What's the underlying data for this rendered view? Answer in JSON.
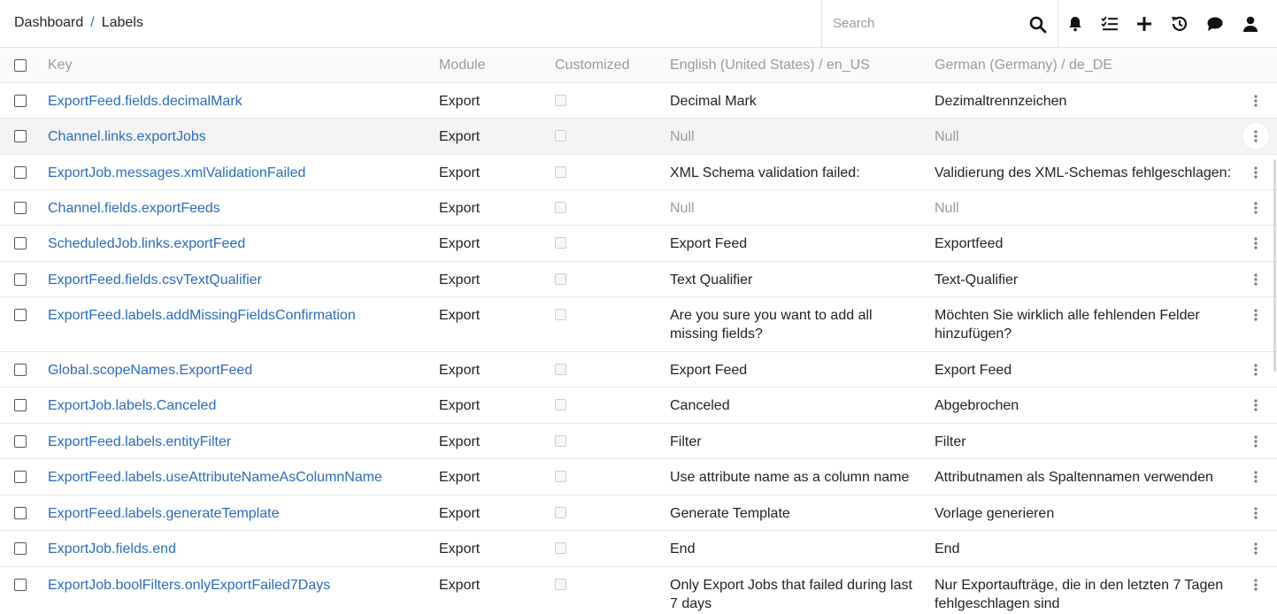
{
  "breadcrumb": {
    "root": "Dashboard",
    "separator": "/",
    "current": "Labels"
  },
  "search": {
    "placeholder": "Search",
    "value": ""
  },
  "header_icons": [
    "bell-icon",
    "tasks-icon",
    "plus-icon",
    "history-icon",
    "chat-icon",
    "user-icon"
  ],
  "table": {
    "columns": {
      "key": "Key",
      "module": "Module",
      "customized": "Customized",
      "en": "English (United States) / en_US",
      "de": "German (Germany) / de_DE"
    },
    "rows": [
      {
        "key": "ExportFeed.fields.decimalMark",
        "module": "Export",
        "en": "Decimal Mark",
        "de": "Dezimaltrennzeichen"
      },
      {
        "key": "Channel.links.exportJobs",
        "module": "Export",
        "en": "Null",
        "de": "Null"
      },
      {
        "key": "ExportJob.messages.xmlValidationFailed",
        "module": "Export",
        "en": "XML Schema validation failed:",
        "de": "Validierung des XML-Schemas fehlgeschlagen:"
      },
      {
        "key": "Channel.fields.exportFeeds",
        "module": "Export",
        "en": "Null",
        "de": "Null"
      },
      {
        "key": "ScheduledJob.links.exportFeed",
        "module": "Export",
        "en": "Export Feed",
        "de": "Exportfeed"
      },
      {
        "key": "ExportFeed.fields.csvTextQualifier",
        "module": "Export",
        "en": "Text Qualifier",
        "de": "Text-Qualifier"
      },
      {
        "key": "ExportFeed.labels.addMissingFieldsConfirmation",
        "module": "Export",
        "en": "Are you sure you want to add all missing fields?",
        "de": "Möchten Sie wirklich alle fehlenden Felder hinzufügen?"
      },
      {
        "key": "Global.scopeNames.ExportFeed",
        "module": "Export",
        "en": "Export Feed",
        "de": "Export Feed"
      },
      {
        "key": "ExportJob.labels.Canceled",
        "module": "Export",
        "en": "Canceled",
        "de": "Abgebrochen"
      },
      {
        "key": "ExportFeed.labels.entityFilter",
        "module": "Export",
        "en": "Filter",
        "de": "Filter"
      },
      {
        "key": "ExportFeed.labels.useAttributeNameAsColumnName",
        "module": "Export",
        "en": "Use attribute name as a column name",
        "de": "Attributnamen als Spaltennamen verwenden"
      },
      {
        "key": "ExportFeed.labels.generateTemplate",
        "module": "Export",
        "en": "Generate Template",
        "de": "Vorlage generieren"
      },
      {
        "key": "ExportJob.fields.end",
        "module": "Export",
        "en": "End",
        "de": "End"
      },
      {
        "key": "ExportJob.boolFilters.onlyExportFailed7Days",
        "module": "Export",
        "en": "Only Export Jobs that failed during last 7 days",
        "de": "Nur Exportaufträge, die in den letzten 7 Tagen fehlgeschlagen sind"
      }
    ]
  },
  "colors": {
    "link": "#2b6cb8",
    "muted": "#9a9a9a",
    "hover_row": "#f4f4f4"
  }
}
